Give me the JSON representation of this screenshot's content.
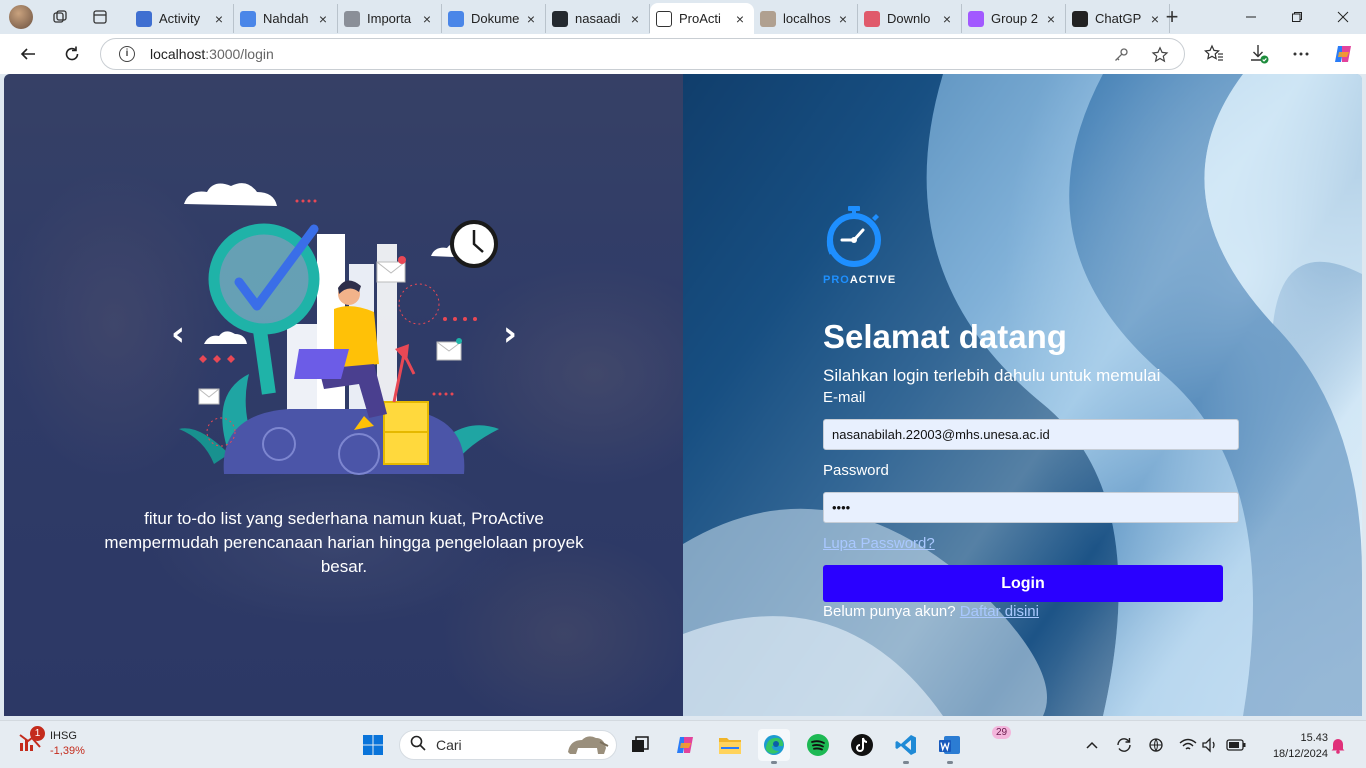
{
  "browser": {
    "tabs": [
      {
        "label": "Activity",
        "favicon_color": "#3f6fd1"
      },
      {
        "label": "Nahdah",
        "favicon_color": "#4a86e8"
      },
      {
        "label": "Importa",
        "favicon_color": "#8a8f98"
      },
      {
        "label": "Dokume",
        "favicon_color": "#4a86e8"
      },
      {
        "label": "nasaadi",
        "favicon_color": "#24292f"
      },
      {
        "label": "ProActi",
        "favicon_color": "#ffffff",
        "active": true
      },
      {
        "label": "localhos",
        "favicon_color": "#b0a090"
      },
      {
        "label": "Downlo",
        "favicon_color": "#e05a6b"
      },
      {
        "label": "Group 2",
        "favicon_color": "#a259ff"
      },
      {
        "label": "ChatGP",
        "favicon_color": "#222222"
      }
    ],
    "address": {
      "host": "localhost",
      "path": ":3000/login"
    }
  },
  "left": {
    "prev_arrow": "‹",
    "next_arrow": "›",
    "caption": "fitur to-do list yang sederhana namun kuat, ProActive mempermudah perencanaan harian hingga pengelolaan proyek besar."
  },
  "login": {
    "logo_pro": "PRO",
    "logo_active": "ACTIVE",
    "title": "Selamat datang",
    "subtitle": "Silahkan login terlebih dahulu untuk memulai",
    "email_label": "E-mail",
    "email_value": "nasanabilah.22003@mhs.unesa.ac.id",
    "password_label": "Password",
    "password_value": "••••",
    "forgot_link": "Lupa Password?",
    "login_button": "Login",
    "register_prompt": "Belum punya akun? ",
    "register_link": "Daftar disini"
  },
  "taskbar": {
    "stock_name": "IHSG",
    "stock_change": "-1,39%",
    "stock_badge": "1",
    "search_placeholder": "Cari",
    "notification_badge": "29",
    "time": "15.43",
    "date": "18/12/2024"
  },
  "colors": {
    "login_button": "#2a00ff",
    "link": "#a9c8ff",
    "accent_blue": "#1e90ff"
  }
}
